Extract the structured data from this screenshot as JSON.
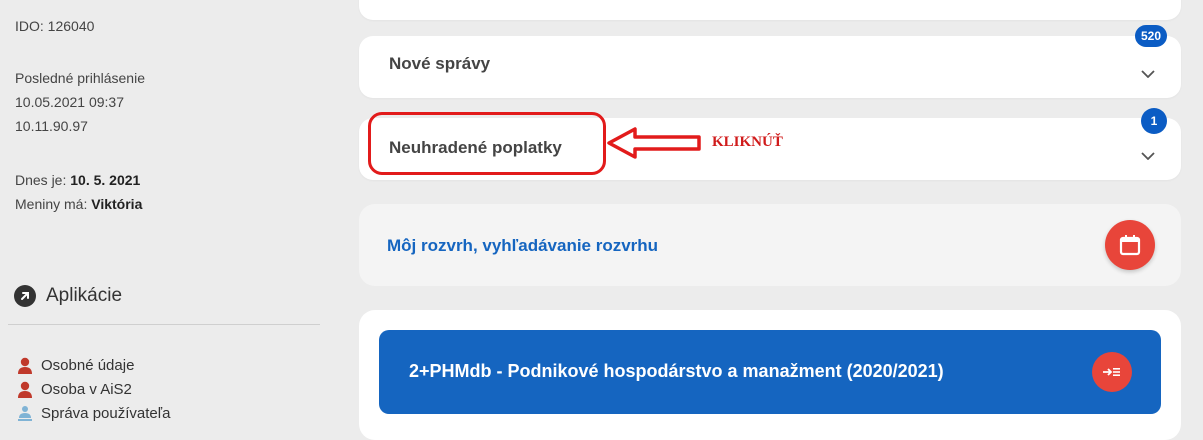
{
  "sidebar": {
    "ido": "IDO: 126040",
    "last_login_label": "Posledné prihlásenie",
    "last_login_date": "10.05.2021 09:37",
    "last_login_ip": "10.11.90.97",
    "today_label": "Dnes je:",
    "today_value": "10. 5. 2021",
    "nameday_label": "Meniny má:",
    "nameday_value": "Viktória",
    "apps_heading": "Aplikácie",
    "apps_icon": "arrow-circle-icon",
    "links": [
      {
        "label": "Osobné údaje",
        "icon": "person-icon"
      },
      {
        "label": "Osoba v AiS2",
        "icon": "person-icon"
      },
      {
        "label": "Správa používateľa",
        "icon": "user-admin-icon"
      }
    ]
  },
  "main": {
    "news": {
      "title": "Nové správy",
      "badge": "520"
    },
    "fees": {
      "title": "Neuhradené poplatky",
      "badge": "1"
    },
    "schedule": {
      "link": "Môj rozvrh, vyhľadávanie rozvrhu",
      "icon": "calendar-icon"
    },
    "study": {
      "title": "2+PHMdb - Podnikové hospodárstvo a manažment (2020/2021)",
      "icon": "enter-list-icon"
    }
  },
  "annotation": {
    "label": "KLIKNÚŤ"
  },
  "colors": {
    "accent_blue": "#1565c0",
    "badge_blue": "#0b5cc4",
    "action_red": "#e8453a",
    "annotation_red": "#e21b1b",
    "person_icon": "#c0392b"
  }
}
